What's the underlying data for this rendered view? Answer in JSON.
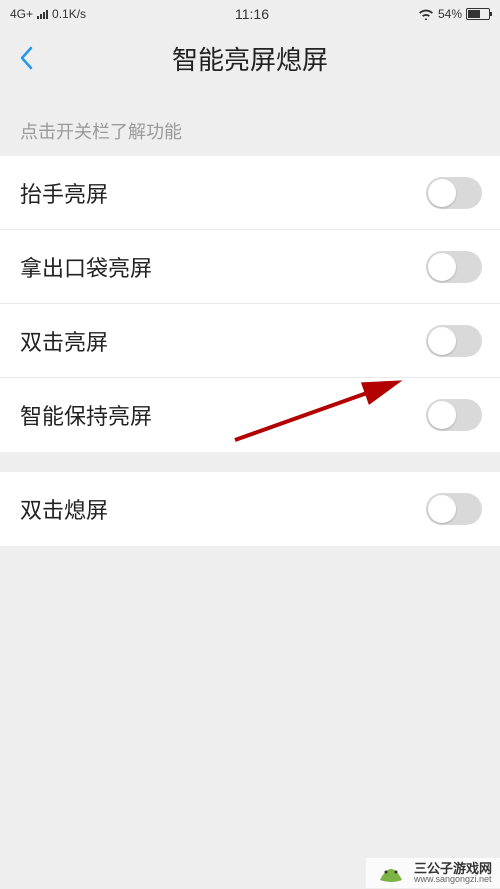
{
  "status": {
    "network": "4G+",
    "speed": "0.1K/s",
    "time": "11:16",
    "battery_pct": "54%"
  },
  "header": {
    "title": "智能亮屏熄屏"
  },
  "hint": "点击开关栏了解功能",
  "settings": {
    "group1": [
      {
        "label": "抬手亮屏",
        "on": false
      },
      {
        "label": "拿出口袋亮屏",
        "on": false
      },
      {
        "label": "双击亮屏",
        "on": false
      },
      {
        "label": "智能保持亮屏",
        "on": false
      }
    ],
    "group2": [
      {
        "label": "双击熄屏",
        "on": false
      }
    ]
  },
  "watermark": {
    "title": "三公子游戏网",
    "url": "www.sangongzi.net"
  }
}
